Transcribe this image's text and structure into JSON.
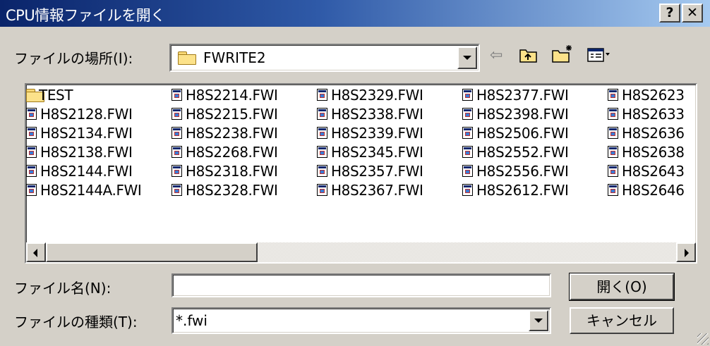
{
  "window": {
    "title": "CPU情報ファイルを開く",
    "help_button": "?",
    "close_button": "✕"
  },
  "location": {
    "label": "ファイルの場所(I):",
    "value": "FWRITE2"
  },
  "toolbar": {
    "icons": [
      "back-arrow-icon",
      "up-folder-icon",
      "new-folder-icon",
      "view-menu-icon"
    ]
  },
  "files": {
    "columns": [
      [
        "TEST",
        "H8S2128.FWI",
        "H8S2134.FWI",
        "H8S2138.FWI",
        "H8S2144.FWI",
        "H8S2144A.FWI"
      ],
      [
        "H8S2214.FWI",
        "H8S2215.FWI",
        "H8S2238.FWI",
        "H8S2268.FWI",
        "H8S2318.FWI",
        "H8S2328.FWI"
      ],
      [
        "H8S2329.FWI",
        "H8S2338.FWI",
        "H8S2339.FWI",
        "H8S2345.FWI",
        "H8S2357.FWI",
        "H8S2367.FWI"
      ],
      [
        "H8S2377.FWI",
        "H8S2398.FWI",
        "H8S2506.FWI",
        "H8S2552.FWI",
        "H8S2556.FWI",
        "H8S2612.FWI"
      ],
      [
        "H8S2623",
        "H8S2633",
        "H8S2636",
        "H8S2638",
        "H8S2643",
        "H8S2646"
      ]
    ]
  },
  "filename": {
    "label": "ファイル名(N):",
    "value": ""
  },
  "filetype": {
    "label": "ファイルの種類(T):",
    "value": "*.fwi"
  },
  "buttons": {
    "open": "開く(O)",
    "cancel": "キャンセル"
  }
}
